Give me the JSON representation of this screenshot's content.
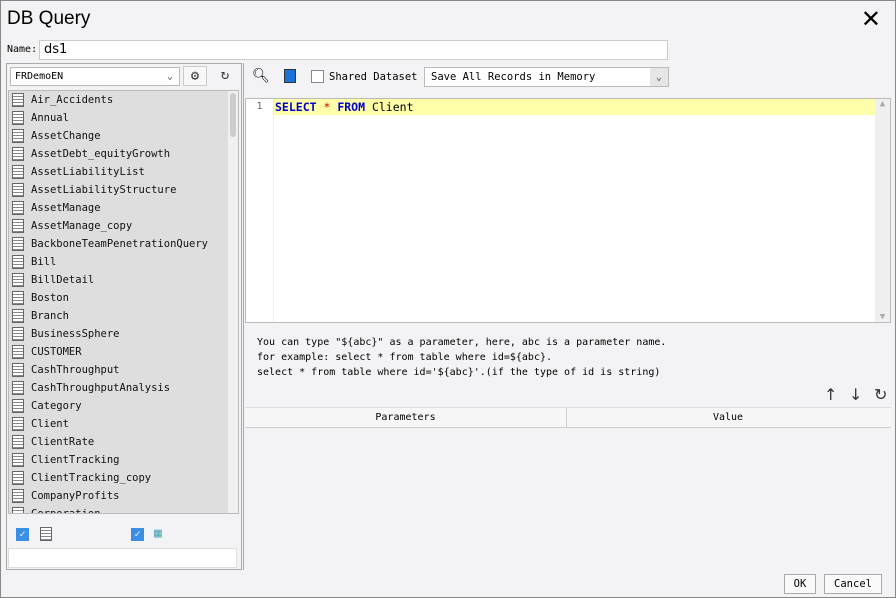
{
  "window": {
    "title": "DB Query"
  },
  "name": {
    "label": "Name:",
    "value": "ds1"
  },
  "left": {
    "database": "FRDemoEN",
    "tables": [
      "Air_Accidents",
      "Annual",
      "AssetChange",
      "AssetDebt_equityGrowth",
      "AssetLiabilityList",
      "AssetLiabilityStructure",
      "AssetManage",
      "AssetManage_copy",
      "BackboneTeamPenetrationQuery",
      "Bill",
      "BillDetail",
      "Boston",
      "Branch",
      "BusinessSphere",
      "CUSTOMER",
      "CashThroughput",
      "CashThroughputAnalysis",
      "Category",
      "Client",
      "ClientRate",
      "ClientTracking",
      "ClientTracking_copy",
      "CompanyProfits",
      "Corporation"
    ]
  },
  "toolbar": {
    "shared_label": "Shared Dataset",
    "memory_option": "Save All Records in Memory"
  },
  "editor": {
    "line_number": "1",
    "kw1": "SELECT",
    "star": " * ",
    "kw2": "FROM",
    "table": " Client"
  },
  "hint": {
    "line1": "You can type \"${abc}\" as a parameter, here, abc is a parameter name.",
    "line2": "for example: select * from table where id=${abc}.",
    "line3": "select * from table where id='${abc}'.(if the type of id is string)"
  },
  "params": {
    "col1": "Parameters",
    "col2": "Value"
  },
  "footer": {
    "ok": "OK",
    "cancel": "Cancel"
  }
}
